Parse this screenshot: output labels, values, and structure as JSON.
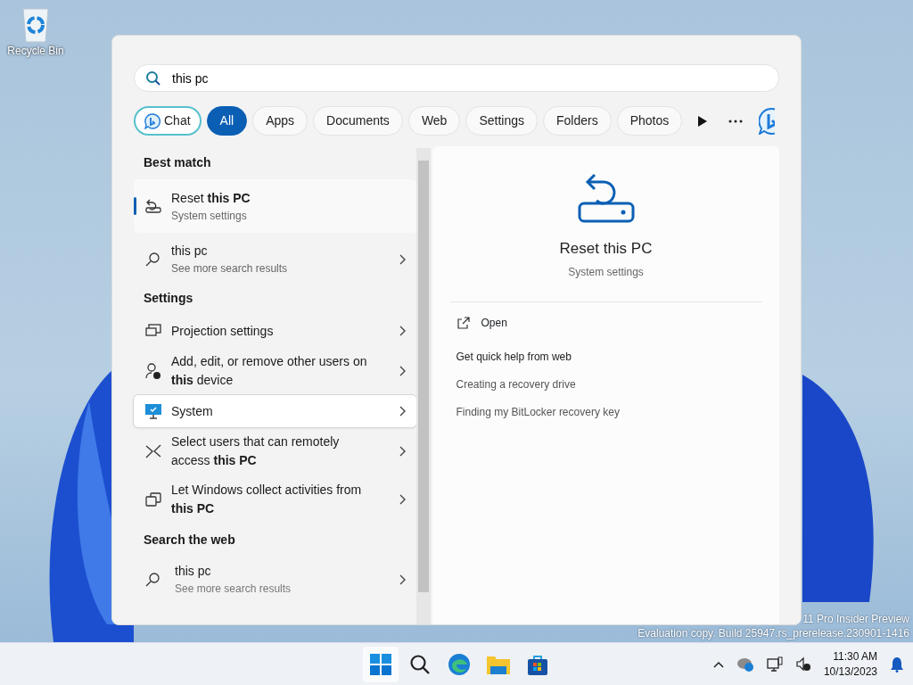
{
  "desktop_icons": [
    {
      "label": "Recycle Bin"
    }
  ],
  "search": {
    "value": "this pc"
  },
  "filters": [
    {
      "label": "Chat",
      "kind": "chat",
      "selected": false
    },
    {
      "label": "All",
      "kind": "pill",
      "selected": true
    },
    {
      "label": "Apps",
      "kind": "pill",
      "selected": false
    },
    {
      "label": "Documents",
      "kind": "pill",
      "selected": false
    },
    {
      "label": "Web",
      "kind": "pill",
      "selected": false
    },
    {
      "label": "Settings",
      "kind": "pill",
      "selected": false
    },
    {
      "label": "Folders",
      "kind": "pill",
      "selected": false
    },
    {
      "label": "Photos",
      "kind": "pill",
      "selected": false
    }
  ],
  "sections": [
    {
      "heading": "Best match",
      "items": [
        {
          "kind": "reset",
          "title": "Reset **this PC**",
          "subtitle": "System settings",
          "selected": true,
          "hovered": false,
          "arrow": false
        }
      ]
    },
    {
      "items": [
        {
          "kind": "search",
          "title": "this pc",
          "subtitle": "See more search results",
          "selected": false,
          "hovered": false,
          "arrow": true
        }
      ]
    },
    {
      "heading": "Settings",
      "items": [
        {
          "kind": "projection",
          "title": "Projection settings",
          "selected": false,
          "hovered": false,
          "arrow": true
        },
        {
          "kind": "users",
          "title": "Add, edit, or remove other users on **this** device",
          "selected": false,
          "hovered": false,
          "arrow": true
        },
        {
          "kind": "system",
          "title": "System",
          "selected": false,
          "hovered": true,
          "arrow": true
        },
        {
          "kind": "remote",
          "title": "Select users that can remotely access **this PC**",
          "selected": false,
          "hovered": false,
          "arrow": true
        },
        {
          "kind": "activity",
          "title": "Let Windows collect activities from **this PC**",
          "selected": false,
          "hovered": false,
          "arrow": true
        }
      ]
    },
    {
      "heading": "Search the web",
      "items": [
        {
          "kind": "websearch",
          "title": "this pc",
          "inline_note": "See more search results",
          "selected": false,
          "hovered": false,
          "arrow": true
        }
      ]
    }
  ],
  "preview": {
    "title": "Reset this PC",
    "subtitle": "System settings",
    "actions": [
      {
        "label": "Open"
      }
    ],
    "help_heading": "Get quick help from web",
    "help_links": [
      "Creating a recovery drive",
      "Finding my BitLocker recovery key"
    ]
  },
  "watermark": [
    "11 Pro Insider Preview",
    "Evaluation copy. Build 25947.rs_prerelease.230901-1416"
  ],
  "clock": {
    "time": "11:30 AM",
    "date": "10/13/2023"
  }
}
